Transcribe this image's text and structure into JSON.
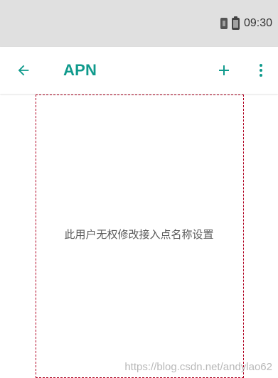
{
  "status_bar": {
    "icons": [
      "sim-card-icon",
      "battery-icon"
    ],
    "time": "09:30"
  },
  "app_bar": {
    "title": "APN",
    "back_icon": "arrow-back-icon",
    "add_icon": "plus-icon",
    "more_icon": "more-vert-icon"
  },
  "content": {
    "message": "此用户无权修改接入点名称设置"
  },
  "watermark": "https://blog.csdn.net/andylao62",
  "colors": {
    "status_bar_bg": "#e0e0e0",
    "app_bar_bg": "#ffffff",
    "accent": "#0f9a8c",
    "content_bg": "#ffffff",
    "message_text": "#5a5a5a",
    "panel_border": "#b00020"
  }
}
